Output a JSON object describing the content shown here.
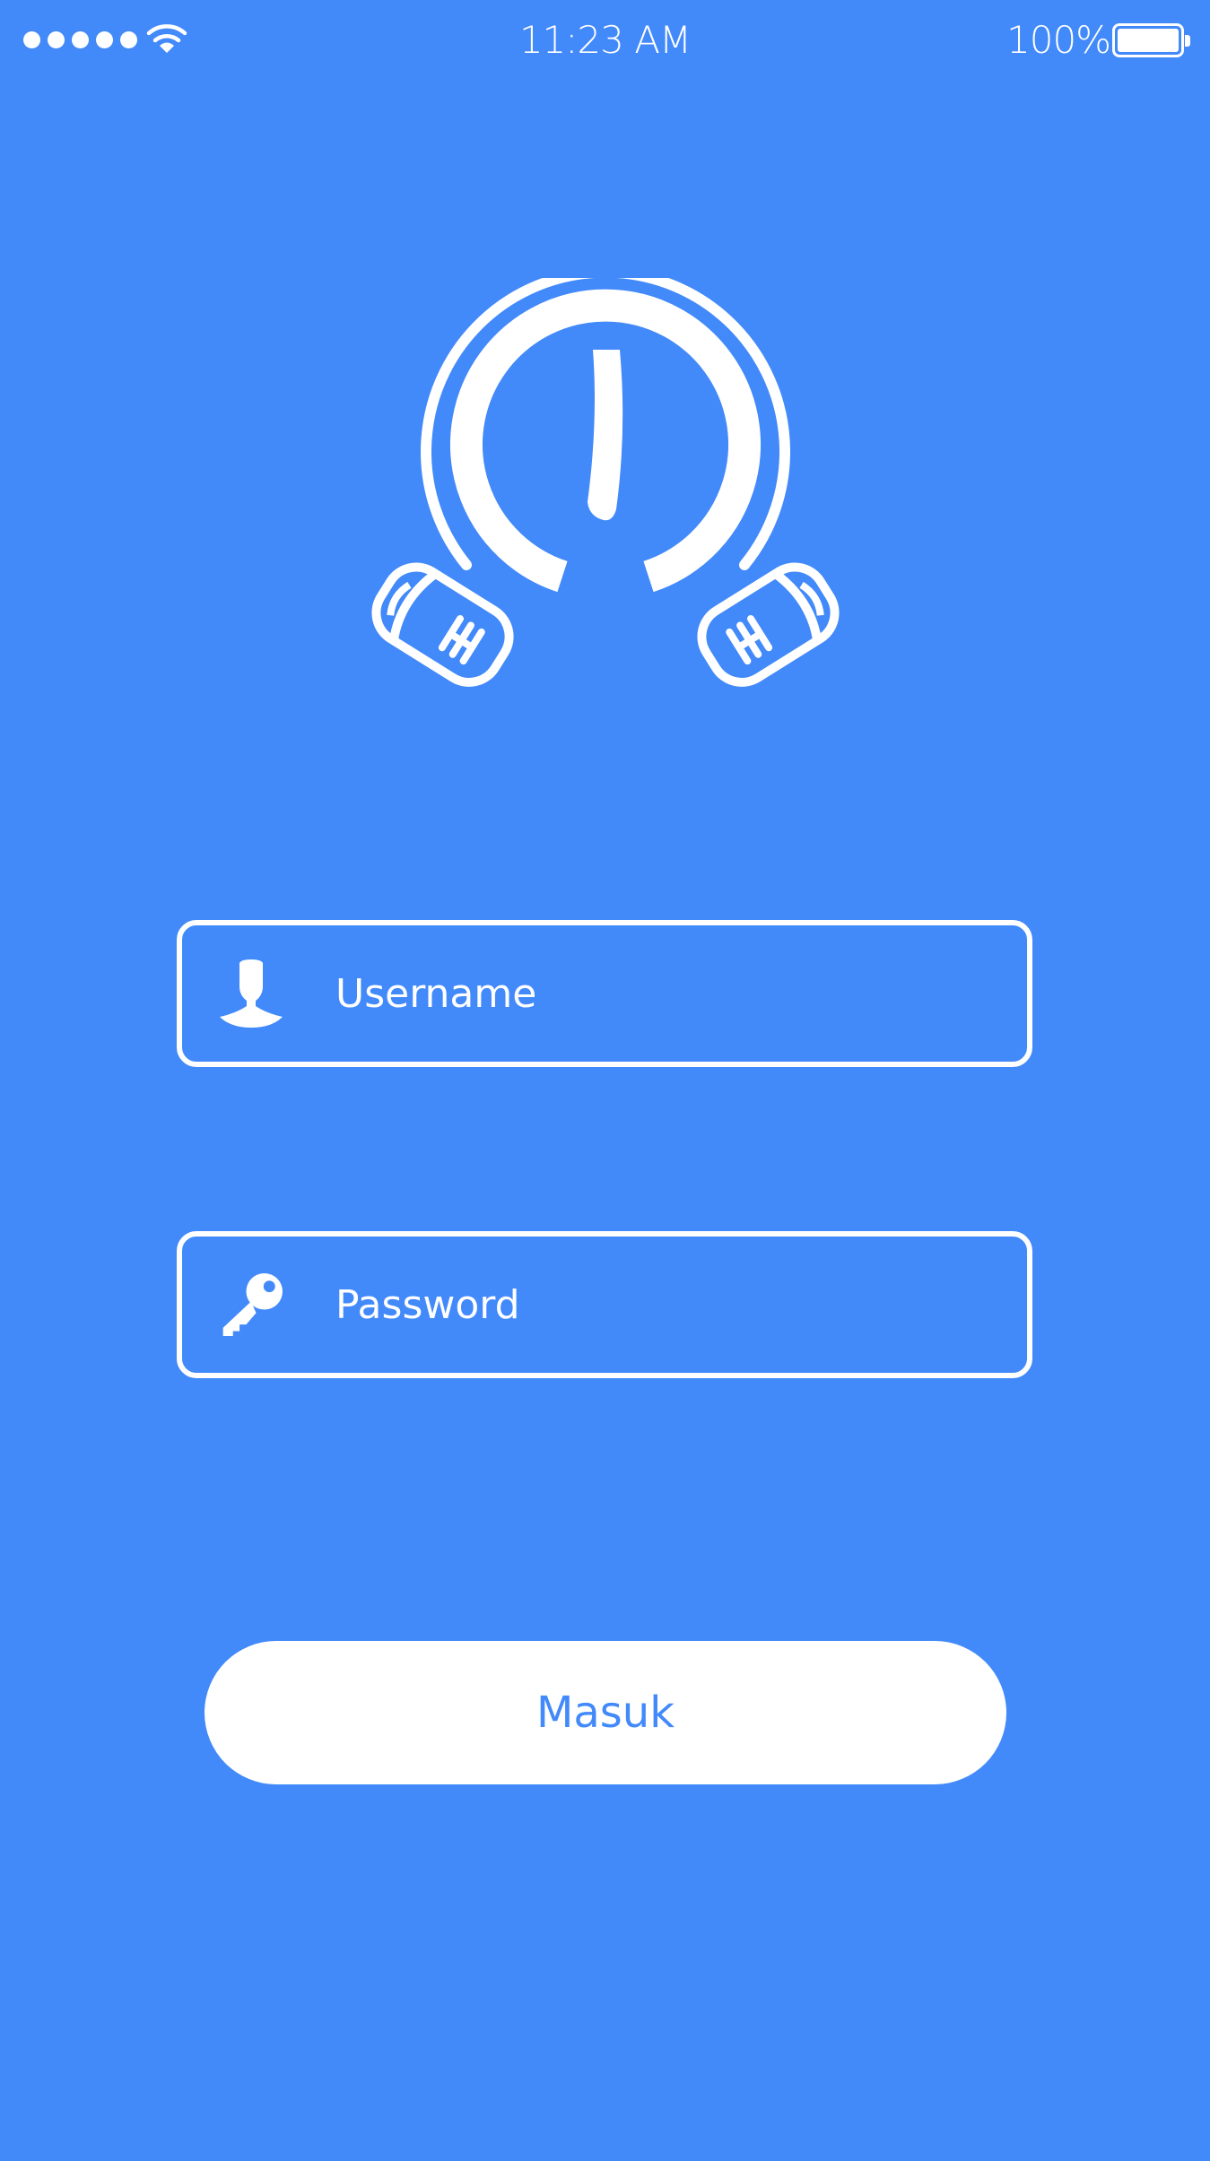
{
  "status_bar": {
    "time": "11:23 AM",
    "battery_percent": "100%",
    "signal_bars": 5,
    "icons": [
      "signal-dots-icon",
      "wifi-icon",
      "battery-icon"
    ]
  },
  "logo": {
    "icon": "headphones-logo-icon"
  },
  "form": {
    "username": {
      "placeholder": "Username",
      "value": "",
      "icon": "user-icon"
    },
    "password": {
      "placeholder": "Password",
      "value": "",
      "icon": "key-icon"
    },
    "submit_label": "Masuk"
  },
  "colors": {
    "background": "#4289FA",
    "foreground": "#FFFFFF",
    "button_text": "#4289FA"
  }
}
